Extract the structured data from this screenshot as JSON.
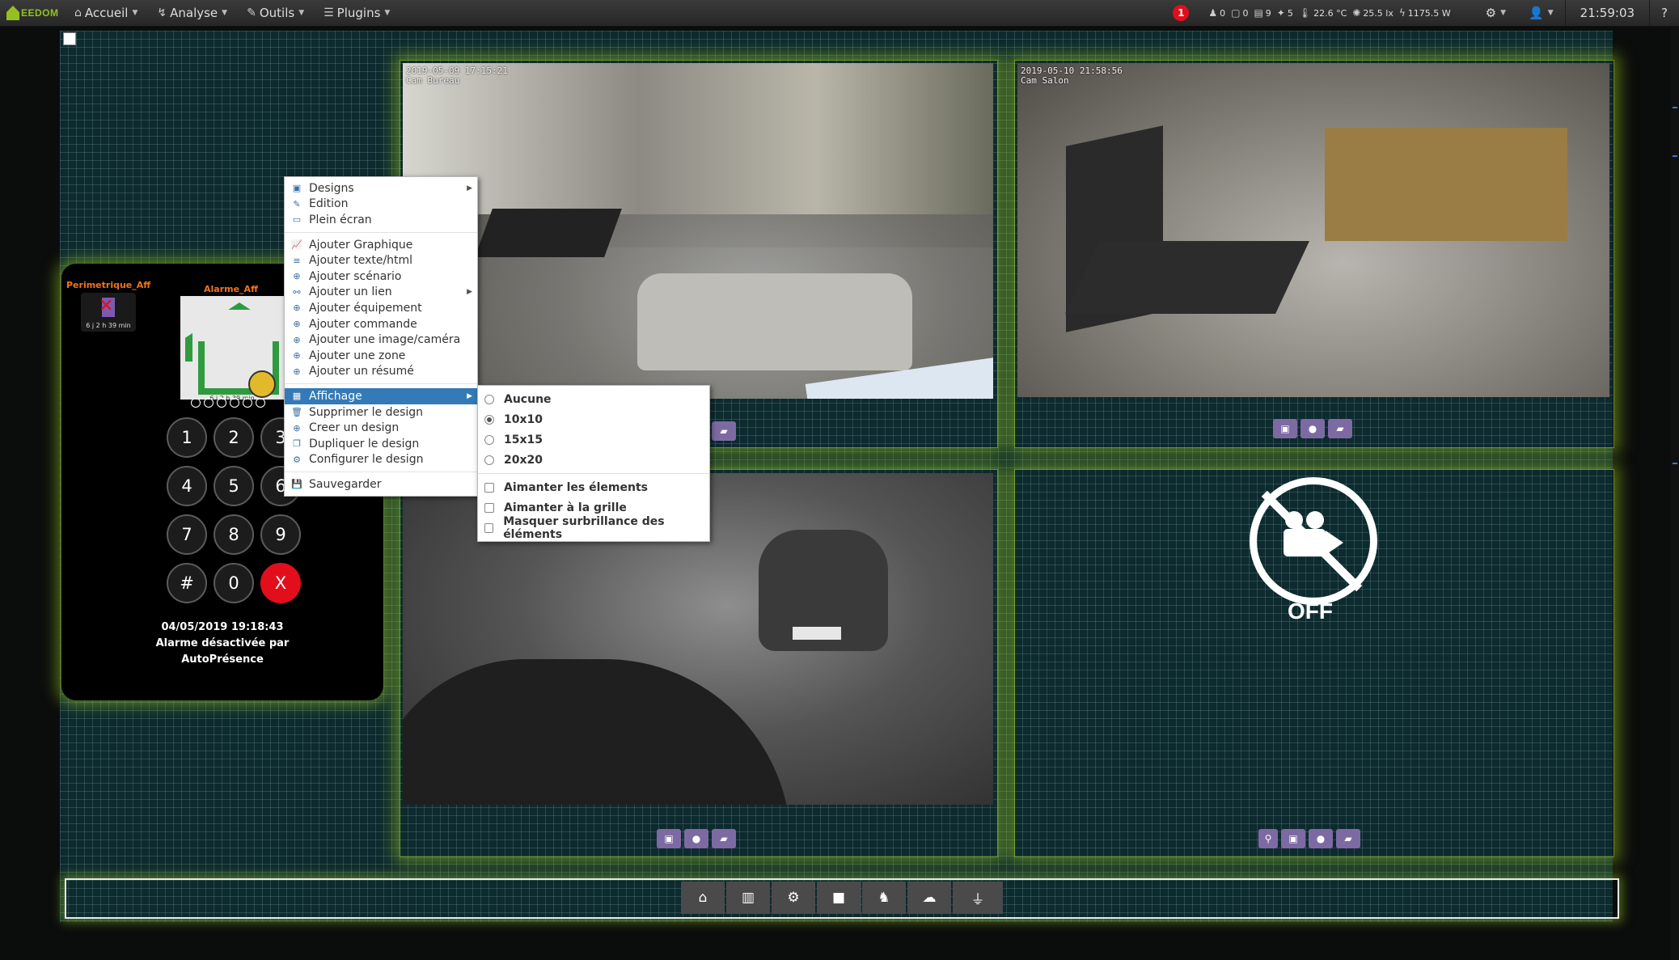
{
  "navbar": {
    "logo": "EEDOM",
    "menus": [
      {
        "label": "Accueil",
        "icon": "home-icon",
        "glyph": "⌂"
      },
      {
        "label": "Analyse",
        "icon": "analyse-icon",
        "glyph": "↯"
      },
      {
        "label": "Outils",
        "icon": "wrench-icon",
        "glyph": "✎"
      },
      {
        "label": "Plugins",
        "icon": "tasks-icon",
        "glyph": "☰"
      }
    ],
    "message_count": "1",
    "summary": [
      {
        "icon": "motion-icon",
        "glyph": "♟",
        "value": "0"
      },
      {
        "icon": "window-icon",
        "glyph": "▢",
        "value": "0"
      },
      {
        "icon": "shutter-icon",
        "glyph": "▤",
        "value": "9"
      },
      {
        "icon": "light-icon",
        "glyph": "✦",
        "value": "5"
      },
      {
        "icon": "temperature-icon",
        "glyph": "🌡",
        "value": "22.6 °C"
      },
      {
        "icon": "luminosity-icon",
        "glyph": "✺",
        "value": "25.5 lx"
      },
      {
        "icon": "power-icon",
        "glyph": "ϟ",
        "value": "1175.5 W"
      }
    ],
    "clock": "21:59:03",
    "help": "?"
  },
  "cameras": [
    {
      "stamp_date": "2019-05-09 17:15:21",
      "stamp_name": "Cam Bureau"
    },
    {
      "stamp_date": "2019-05-10 21:58:56",
      "stamp_name": "Cam Salon"
    }
  ],
  "camera_off_label": "OFF",
  "alarm": {
    "perimetre_title": "Perimetrique_Aff",
    "alarme_title": "Alarme_Aff",
    "perimetre_age": "6 j 2 h 39 min",
    "alarme_age": "6 j 2 h 39 min",
    "keys": [
      "1",
      "2",
      "3",
      "4",
      "5",
      "6",
      "7",
      "8",
      "9",
      "#",
      "0",
      "X"
    ],
    "status_date": "04/05/2019 19:18:43",
    "status_line1": "Alarme désactivée par",
    "status_line2": "AutoPrésence"
  },
  "context_menu": {
    "designs": "Designs",
    "edition": "Edition",
    "plein_ecran": "Plein écran",
    "ajouter_graphique": "Ajouter Graphique",
    "ajouter_texte": "Ajouter texte/html",
    "ajouter_scenario": "Ajouter scénario",
    "ajouter_lien": "Ajouter un lien",
    "ajouter_equipement": "Ajouter équipement",
    "ajouter_commande": "Ajouter commande",
    "ajouter_image": "Ajouter une image/caméra",
    "ajouter_zone": "Ajouter une zone",
    "ajouter_resume": "Ajouter un résumé",
    "affichage": "Affichage",
    "supprimer": "Supprimer le design",
    "creer": "Creer un design",
    "dupliquer": "Dupliquer le design",
    "configurer": "Configurer le design",
    "sauvegarder": "Sauvegarder"
  },
  "affichage_submenu": {
    "aucune": "Aucune",
    "g10": "10x10",
    "g15": "15x15",
    "g20": "20x20",
    "selected_grid": "10x10",
    "aimanter_elements": "Aimanter les élements",
    "aimanter_grille": "Aimanter à la grille",
    "masquer_surbrillance": "Masquer surbrillance des éléments"
  },
  "colors": {
    "accent_green": "#94c11f",
    "menu_highlight": "#337ab7",
    "alarm_red": "#e30e1c",
    "widget_title_orange": "#f0741c",
    "camera_button_purple": "#7d6aa3"
  }
}
